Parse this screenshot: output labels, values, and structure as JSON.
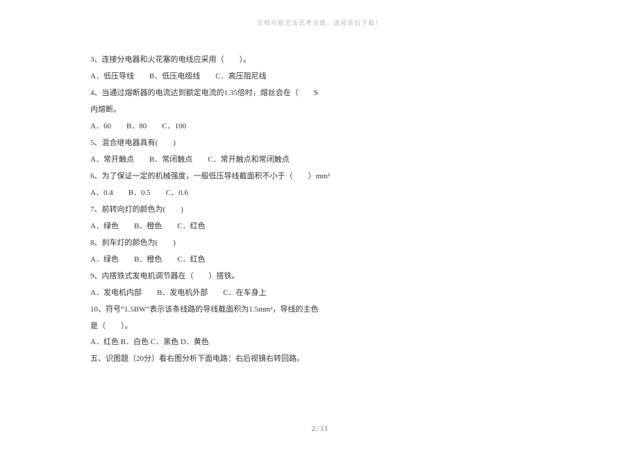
{
  "watermark": "文档可能无法思考全面，请阅览后下载！",
  "lines": {
    "q3": "3、连接分电器和火花塞的电线应采用（　　）。",
    "q3_opts": "A．低压导线　　B．低压电缆线　　C．高压阻尼线",
    "q4": "4、当通过熔断器的电流达到额定电流的1.35倍时，熔丝会在（　　S",
    "q4b": "内熔断。",
    "q4_opts": "A．60　　B．80　　C．100",
    "q5": "5、混合继电器具有(　　)",
    "q5_opts": "A．常开触点　　B．常闭触点　　C．常开触点和常闭触点",
    "q6": "6、为了保证一定的机械强度，一般低压导线截面积不小于（　　）mm²",
    "q6_opts": "A．0.4　　B．0.5　　C．0.6",
    "q7": "7、前转向灯的颜色为(　　)",
    "q7_opts": "A．绿色　　B．橙色　　C．红色",
    "q8": "8、刹车灯的颜色为(　　)",
    "q8_opts": "A．绿色　　B．橙色　　C．红色",
    "q9": "9、内搭铁式发电机调节器在（　　）搭铁。",
    "q9_opts": "A．发电机内部　　B．发电机外部　　C．在车身上",
    "q10": "10、符号“1.5BW”表示该条线路的导线截面积为1.5mm²，导线的主色",
    "q10b": "是（　　）。",
    "q10_opts": "A．红色 B．白色 C．黑色 D．黄色",
    "section5": "五、识图题（20分）看右图分析下面电路：右后视镜右转回路。"
  },
  "page_number": "2 / 13"
}
